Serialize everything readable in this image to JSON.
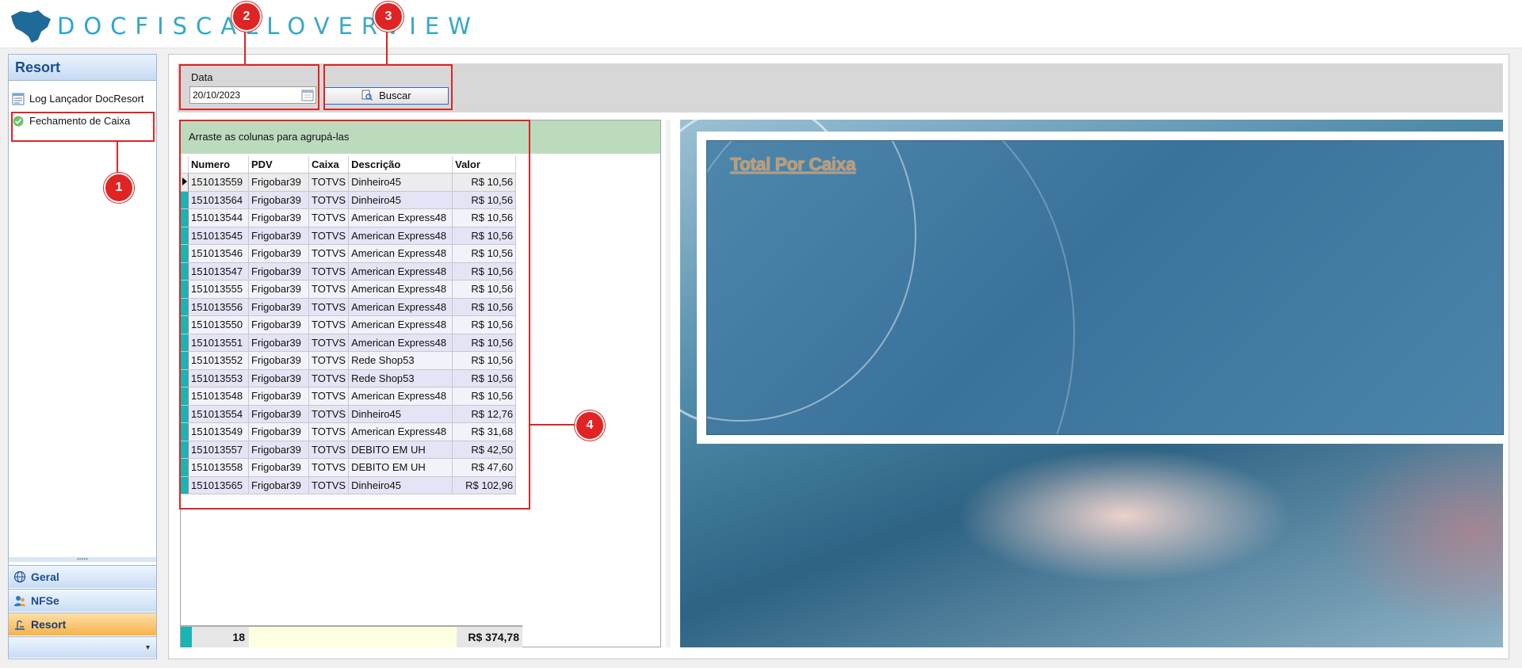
{
  "header": {
    "logo_doc": "DOC",
    "logo_fiscall": "FISCALL",
    "logo_overview": "OVERVIEW"
  },
  "sidebar": {
    "title": "Resort",
    "items": [
      {
        "label": "Log Lançador DocResort",
        "icon": "log-list-icon"
      },
      {
        "label": "Fechamento de Caixa",
        "icon": "check-circle-icon"
      }
    ],
    "nav": [
      {
        "label": "Geral",
        "icon": "globe-icon"
      },
      {
        "label": "NFSe",
        "icon": "users-icon"
      },
      {
        "label": "Resort",
        "icon": "resort-icon",
        "active": true
      }
    ]
  },
  "filter": {
    "date_label": "Data",
    "date_value": "20/10/2023",
    "search_button": "Buscar"
  },
  "grid": {
    "group_hint": "Arraste as colunas para agrupá-las",
    "columns": [
      "Numero",
      "PDV",
      "Caixa",
      "Descrição",
      "Valor"
    ],
    "rows": [
      [
        "151013559",
        "Frigobar39",
        "TOTVS",
        "Dinheiro45",
        "R$ 10,56"
      ],
      [
        "151013564",
        "Frigobar39",
        "TOTVS",
        "Dinheiro45",
        "R$ 10,56"
      ],
      [
        "151013544",
        "Frigobar39",
        "TOTVS",
        "American Express48",
        "R$ 10,56"
      ],
      [
        "151013545",
        "Frigobar39",
        "TOTVS",
        "American Express48",
        "R$ 10,56"
      ],
      [
        "151013546",
        "Frigobar39",
        "TOTVS",
        "American Express48",
        "R$ 10,56"
      ],
      [
        "151013547",
        "Frigobar39",
        "TOTVS",
        "American Express48",
        "R$ 10,56"
      ],
      [
        "151013555",
        "Frigobar39",
        "TOTVS",
        "American Express48",
        "R$ 10,56"
      ],
      [
        "151013556",
        "Frigobar39",
        "TOTVS",
        "American Express48",
        "R$ 10,56"
      ],
      [
        "151013550",
        "Frigobar39",
        "TOTVS",
        "American Express48",
        "R$ 10,56"
      ],
      [
        "151013551",
        "Frigobar39",
        "TOTVS",
        "American Express48",
        "R$ 10,56"
      ],
      [
        "151013552",
        "Frigobar39",
        "TOTVS",
        "Rede Shop53",
        "R$ 10,56"
      ],
      [
        "151013553",
        "Frigobar39",
        "TOTVS",
        "Rede Shop53",
        "R$ 10,56"
      ],
      [
        "151013548",
        "Frigobar39",
        "TOTVS",
        "American Express48",
        "R$ 10,56"
      ],
      [
        "151013554",
        "Frigobar39",
        "TOTVS",
        "Dinheiro45",
        "R$ 12,76"
      ],
      [
        "151013549",
        "Frigobar39",
        "TOTVS",
        "American Express48",
        "R$ 31,68"
      ],
      [
        "151013557",
        "Frigobar39",
        "TOTVS",
        "DEBITO EM UH",
        "R$ 42,50"
      ],
      [
        "151013558",
        "Frigobar39",
        "TOTVS",
        "DEBITO EM UH",
        "R$ 47,60"
      ],
      [
        "151013565",
        "Frigobar39",
        "TOTVS",
        "Dinheiro45",
        "R$ 102,96"
      ]
    ],
    "footer_count": "18",
    "footer_total": "R$ 374,78"
  },
  "chart": {
    "title": "Total Por Caixa"
  },
  "annotations": [
    "1",
    "2",
    "3",
    "4"
  ],
  "colors": {
    "annotation": "#e02424",
    "row_indicator": "#19b4b4",
    "group_band": "#bcdbbd",
    "nav_active": "#f6b24d"
  }
}
